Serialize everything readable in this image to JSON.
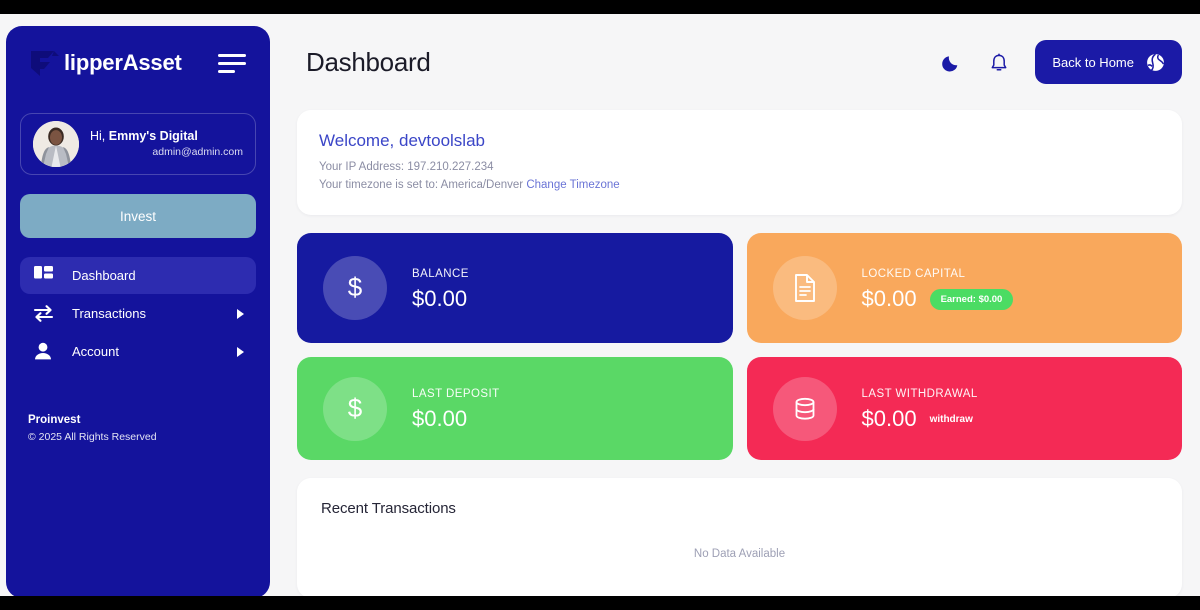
{
  "sidebar": {
    "logo_icon": "flipper-logo-icon",
    "brand_name": "lipperAsset",
    "menu_icon": "hamburger-menu-icon",
    "user": {
      "greeting_prefix": "Hi, ",
      "name": "Emmy's Digital",
      "email": "admin@admin.com",
      "avatar_icon": "user-avatar-photo"
    },
    "invest_label": "Invest",
    "items": [
      {
        "label": "Dashboard",
        "icon": "grid-dashboard-icon",
        "active": true,
        "has_chevron": false
      },
      {
        "label": "Transactions",
        "icon": "exchange-arrows-icon",
        "active": false,
        "has_chevron": true
      },
      {
        "label": "Account",
        "icon": "person-icon",
        "active": false,
        "has_chevron": true
      }
    ],
    "footer": {
      "brand": "Proinvest",
      "copyright": "© 2025 All Rights Reserved"
    }
  },
  "header": {
    "title": "Dashboard",
    "dark_mode_icon": "moon-icon",
    "notification_icon": "bell-icon",
    "home_button_label": "Back to Home",
    "home_button_icon": "globe-icon"
  },
  "welcome": {
    "title": "Welcome, devtoolslab",
    "ip_line": "Your IP Address: 197.210.227.234",
    "timezone_line": "Your timezone is set to: America/Denver",
    "timezone_link": "Change Timezone"
  },
  "stats": [
    {
      "key": "balance",
      "label": "BALANCE",
      "value": "$0.00",
      "icon": "dollar-sign-icon",
      "color": "#161aa0",
      "badge": null
    },
    {
      "key": "locked_capital",
      "label": "LOCKED CAPITAL",
      "value": "$0.00",
      "icon": "document-icon",
      "color": "#f9a85c",
      "badge": "Earned: $0.00",
      "badge_color": "#4bdc63"
    },
    {
      "key": "last_deposit",
      "label": "LAST DEPOSIT",
      "value": "$0.00",
      "icon": "dollar-sign-icon",
      "color": "#5ad866",
      "badge": null
    },
    {
      "key": "last_withdrawal",
      "label": "LAST WITHDRAWAL",
      "value": "$0.00",
      "icon": "database-icon",
      "color": "#f42a55",
      "badge": null,
      "action_label": "withdraw"
    }
  ],
  "recent": {
    "title": "Recent Transactions",
    "empty_text": "No Data Available"
  },
  "colors": {
    "sidebar_bg": "#14139c",
    "page_bg": "#f6f6f7",
    "accent": "#1b1aa6",
    "invest_btn": "#7dabc4",
    "active_nav": "#2d2cb0"
  }
}
